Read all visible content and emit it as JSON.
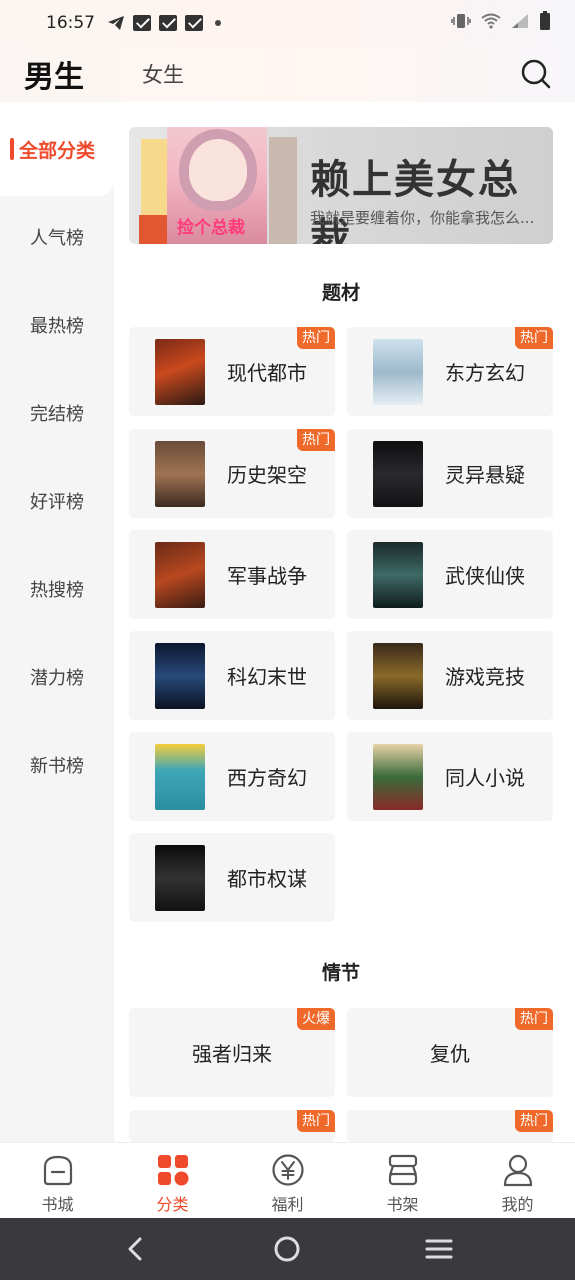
{
  "status_bar": {
    "time": "16:57"
  },
  "header": {
    "tab_male": "男生",
    "tab_female": "女生"
  },
  "sidebar": {
    "items": [
      {
        "label": "全部分类",
        "active": true
      },
      {
        "label": "人气榜"
      },
      {
        "label": "最热榜"
      },
      {
        "label": "完结榜"
      },
      {
        "label": "好评榜"
      },
      {
        "label": "热搜榜"
      },
      {
        "label": "潜力榜"
      },
      {
        "label": "新书榜"
      }
    ]
  },
  "banner": {
    "title": "赖上美女总裁",
    "subtitle": "我就是要缠着你，你能拿我怎么...",
    "cover_title": "捡个总裁"
  },
  "sections": {
    "theme_title": "题材",
    "plot_title": "情节"
  },
  "theme_cards": [
    {
      "label": "现代都市",
      "badge": "热门"
    },
    {
      "label": "东方玄幻",
      "badge": "热门"
    },
    {
      "label": "历史架空",
      "badge": "热门"
    },
    {
      "label": "灵异悬疑",
      "badge": ""
    },
    {
      "label": "军事战争",
      "badge": ""
    },
    {
      "label": "武侠仙侠",
      "badge": ""
    },
    {
      "label": "科幻末世",
      "badge": ""
    },
    {
      "label": "游戏竞技",
      "badge": ""
    },
    {
      "label": "西方奇幻",
      "badge": ""
    },
    {
      "label": "同人小说",
      "badge": ""
    },
    {
      "label": "都市权谋",
      "badge": ""
    }
  ],
  "plot_cards": [
    {
      "label": "强者归来",
      "badge": "火爆"
    },
    {
      "label": "复仇",
      "badge": "热门"
    },
    {
      "label": "",
      "badge": "热门"
    },
    {
      "label": "",
      "badge": "热门"
    }
  ],
  "bottom_nav": [
    {
      "label": "书城",
      "icon": "bookstore-icon"
    },
    {
      "label": "分类",
      "icon": "category-icon",
      "active": true
    },
    {
      "label": "福利",
      "icon": "yen-icon"
    },
    {
      "label": "书架",
      "icon": "bookshelf-icon"
    },
    {
      "label": "我的",
      "icon": "profile-icon"
    }
  ],
  "colors": {
    "accent": "#ef4a2c",
    "badge": "#ef6a2a"
  }
}
